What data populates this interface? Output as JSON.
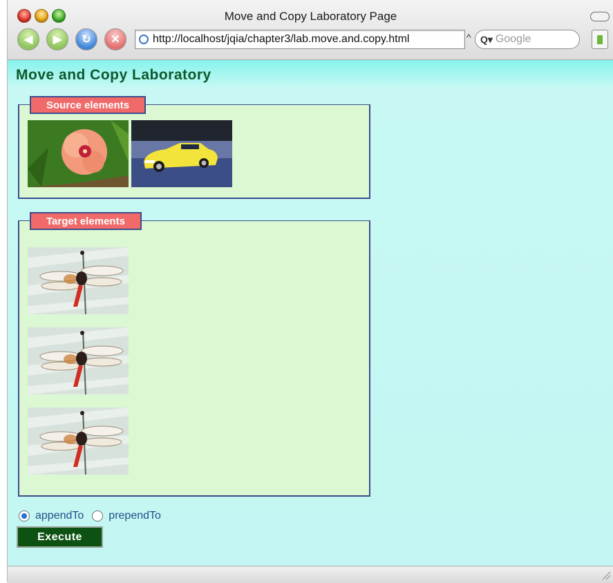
{
  "window": {
    "title": "Move and Copy Laboratory Page"
  },
  "toolbar": {
    "url": "http://localhost/jqia/chapter3/lab.move.and.copy.html",
    "search_placeholder": "Google",
    "icons": [
      "back-icon",
      "forward-icon",
      "reload-icon",
      "stop-icon",
      "globe-icon",
      "search-icon",
      "bookmark-icon"
    ]
  },
  "page": {
    "heading": "Move and Copy Laboratory",
    "source_legend": "Source elements",
    "target_legend": "Target elements",
    "source_images": [
      "flower-image",
      "car-image"
    ],
    "target_images": [
      "dragonfly-image",
      "dragonfly-image",
      "dragonfly-image"
    ],
    "options": [
      {
        "label": "appendTo",
        "checked": true
      },
      {
        "label": "prependTo",
        "checked": false
      }
    ],
    "execute_label": "Execute"
  },
  "colors": {
    "heading": "#0c5a2e",
    "legend_bg": "#f06a6a",
    "fieldset_bg": "#dbf8d2",
    "content_bg": "#c3f6f2",
    "execute_bg": "#0d5212"
  }
}
